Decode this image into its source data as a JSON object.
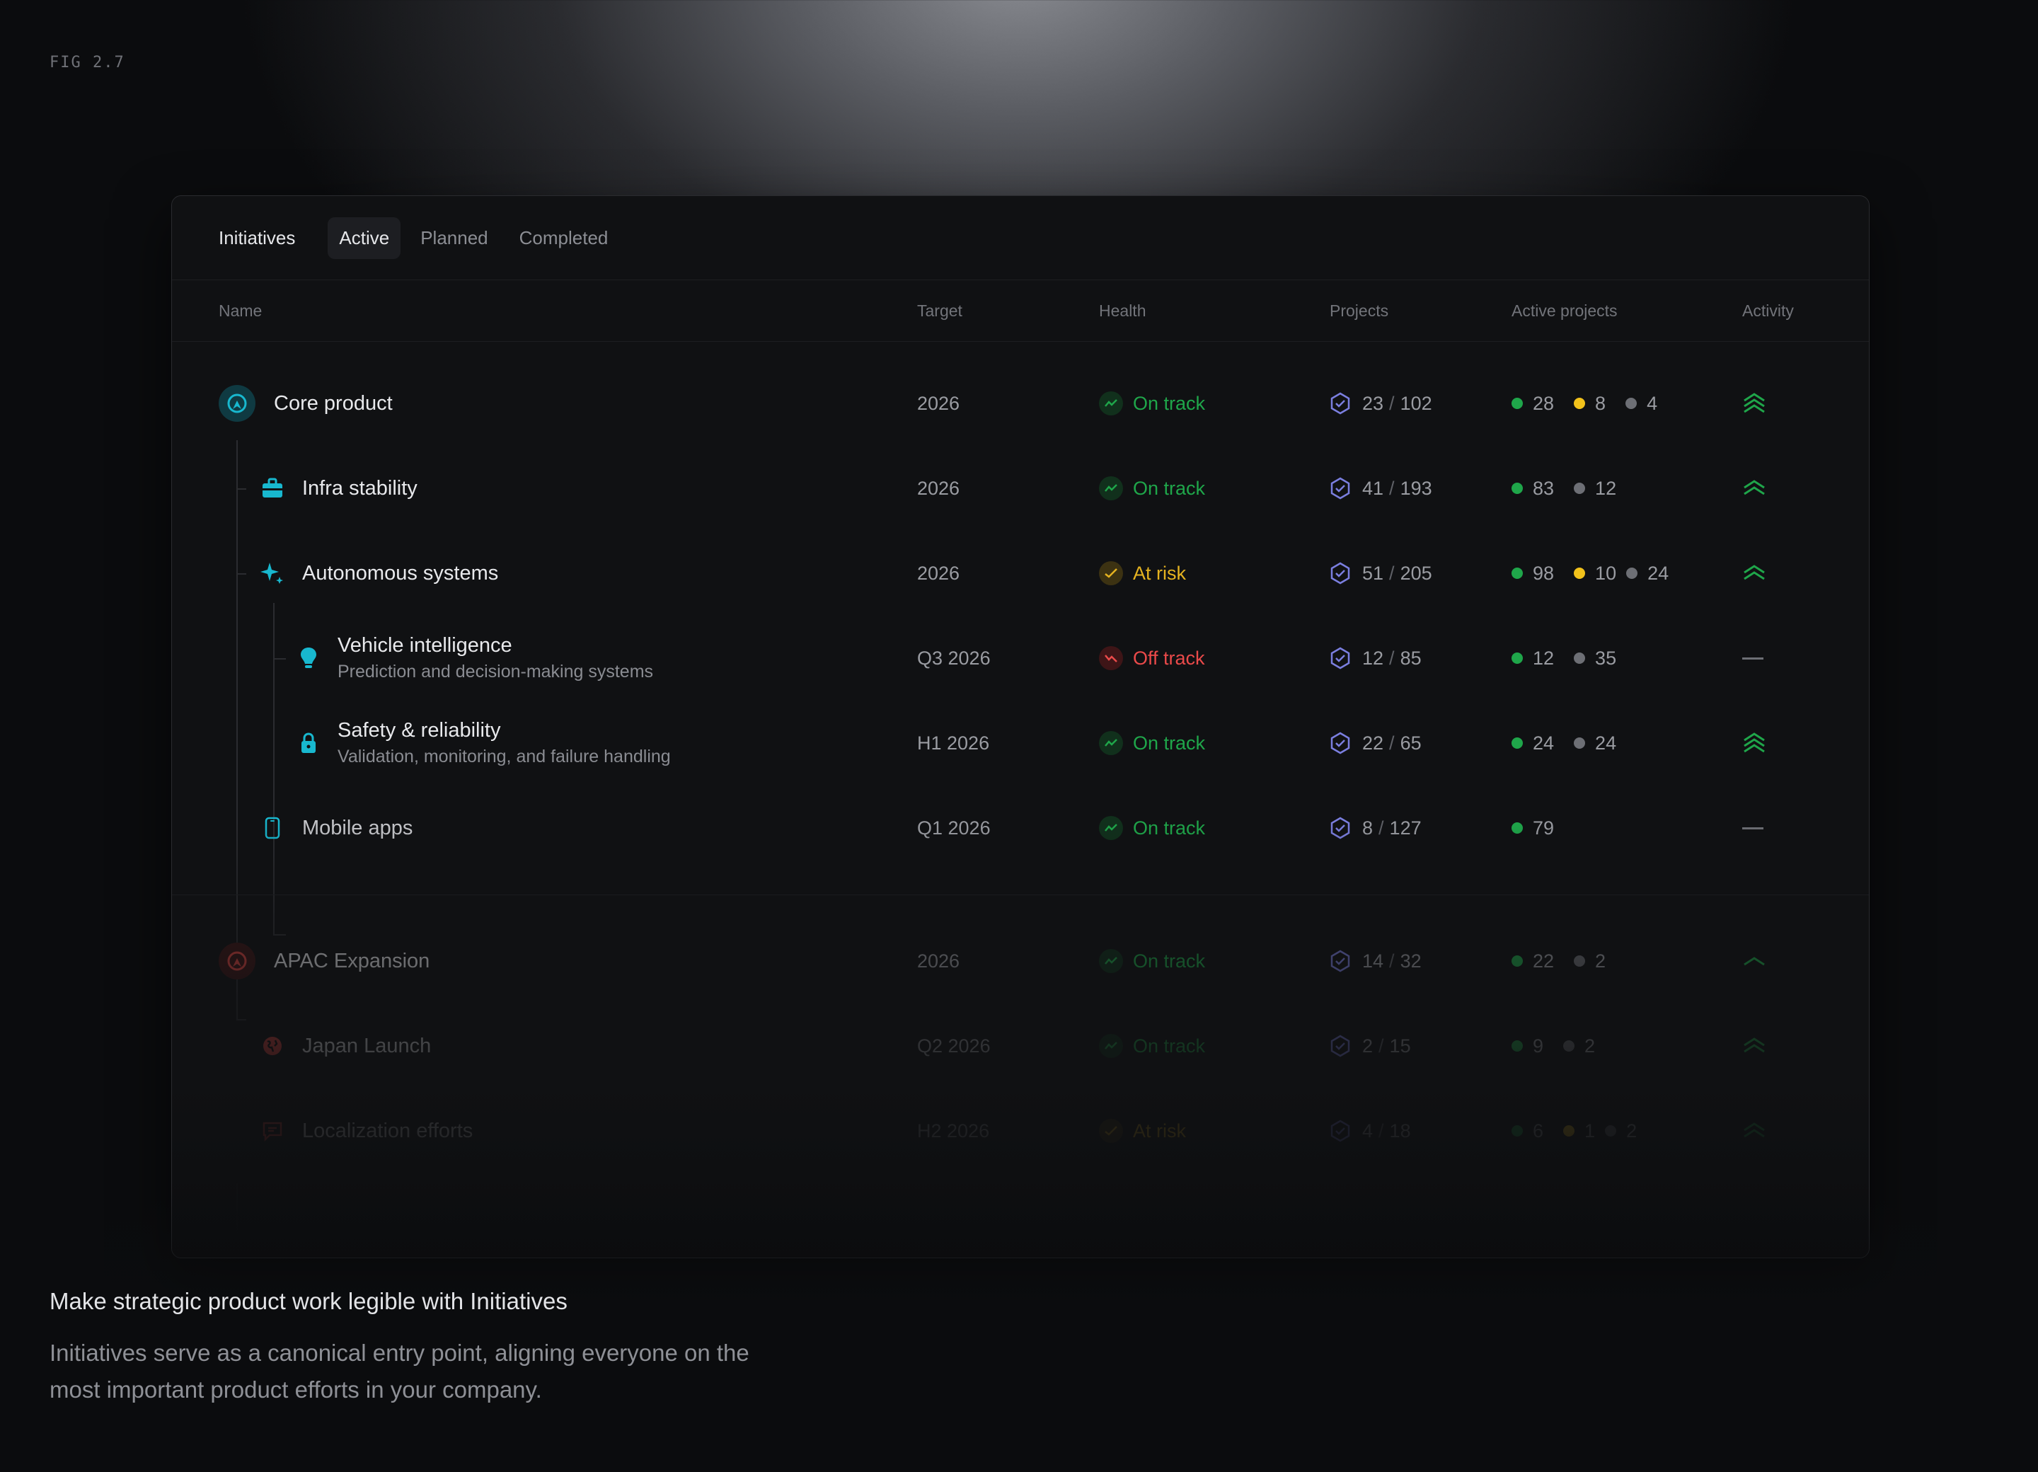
{
  "figure_label": "FIG 2.7",
  "tabs": {
    "title": "Initiatives",
    "items": [
      "Active",
      "Planned",
      "Completed"
    ]
  },
  "columns": [
    "Name",
    "Target",
    "Health",
    "Projects",
    "Active projects",
    "Activity"
  ],
  "rows": [
    {
      "name": "Core product",
      "target": "2026",
      "health": "On track",
      "projects_done": "23",
      "projects_total": "102",
      "active": [
        "28",
        "8",
        "4"
      ],
      "icon": "core-product-icon"
    },
    {
      "name": "Infra stability",
      "target": "2026",
      "health": "On track",
      "projects_done": "41",
      "projects_total": "193",
      "active": [
        "83",
        "12"
      ],
      "icon": "toolbox-icon"
    },
    {
      "name": "Autonomous systems",
      "target": "2026",
      "health": "At risk",
      "projects_done": "51",
      "projects_total": "205",
      "active": [
        "98",
        "10",
        "24"
      ],
      "icon": "sparkle-icon"
    },
    {
      "name": "Vehicle intelligence",
      "sub": "Prediction and decision-making systems",
      "target": "Q3 2026",
      "health": "Off track",
      "projects_done": "12",
      "projects_total": "85",
      "active": [
        "12",
        "35"
      ],
      "icon": "lightbulb-icon"
    },
    {
      "name": "Safety & reliability",
      "sub": "Validation, monitoring, and failure handling",
      "target": "H1 2026",
      "health": "On track",
      "projects_done": "22",
      "projects_total": "65",
      "active": [
        "24",
        "24"
      ],
      "icon": "lock-icon"
    },
    {
      "name": "Mobile apps",
      "target": "Q1 2026",
      "health": "On track",
      "projects_done": "8",
      "projects_total": "127",
      "active": [
        "79"
      ],
      "icon": "phone-icon"
    },
    {
      "name": "APAC Expansion",
      "target": "2026",
      "health": "On track",
      "projects_done": "14",
      "projects_total": "32",
      "active": [
        "22",
        "2"
      ],
      "icon": "apac-icon"
    },
    {
      "name": "Japan Launch",
      "target": "Q2 2026",
      "health": "On track",
      "projects_done": "2",
      "projects_total": "15",
      "active": [
        "9",
        "2"
      ],
      "icon": "globe-icon"
    },
    {
      "name": "Localization efforts",
      "target": "H2 2026",
      "health": "At risk",
      "projects_done": "4",
      "projects_total": "18",
      "active": [
        "6",
        "1",
        "2"
      ],
      "icon": "chat-icon"
    }
  ],
  "caption": {
    "title": "Make strategic product work legible with Initiatives",
    "body": "Initiatives serve as a canonical entry point, aligning everyone on the most important product efforts in your company."
  },
  "colors": {
    "on_track": "#1fa64a",
    "at_risk": "#e5b320",
    "off_track": "#ea4a4a",
    "project_icon": "#7b7fe0",
    "initiative_icon": "#18b8cf"
  }
}
